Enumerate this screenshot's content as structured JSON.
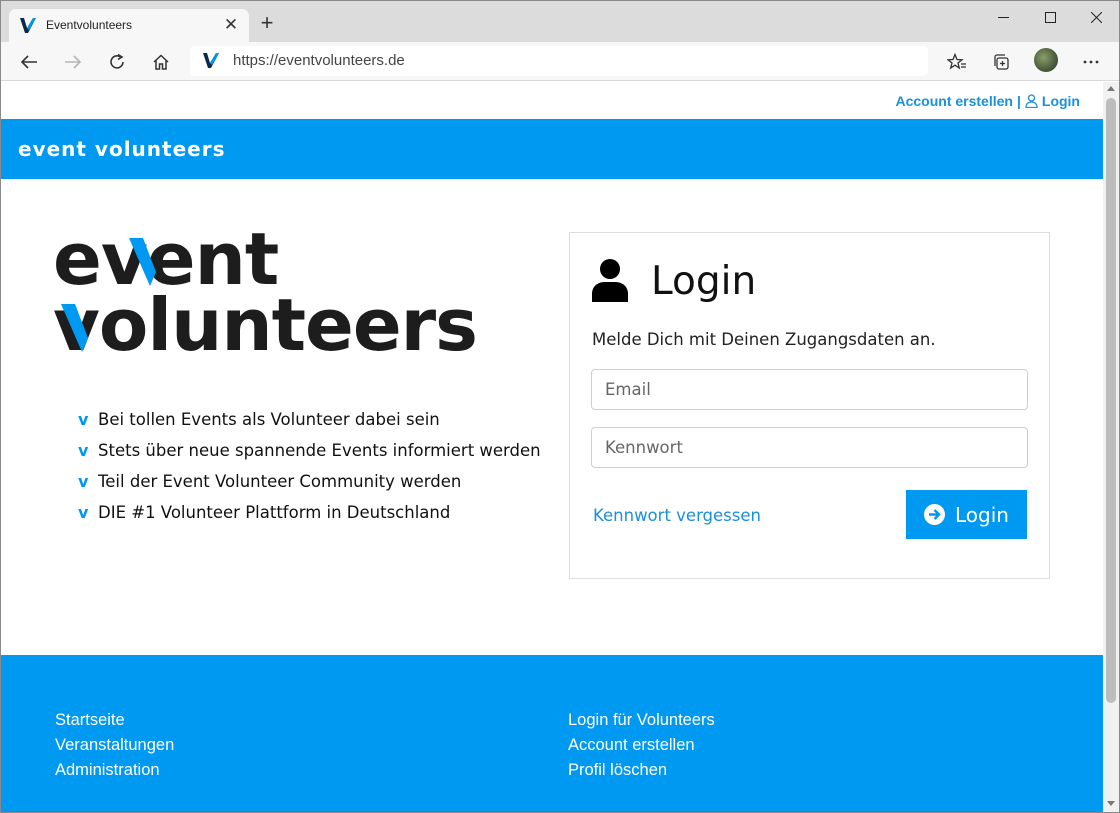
{
  "browser": {
    "tab_title": "Eventvolunteers",
    "tab_close": "✕",
    "new_tab": "+",
    "url": "https://eventvolunteers.de"
  },
  "header": {
    "account_create": "Account erstellen",
    "separator": "|",
    "login": "Login",
    "brand": "event volunteers"
  },
  "hero": {
    "logo_line1": "event",
    "logo_line2": "volunteers",
    "check_mark": "v",
    "features": [
      "Bei tollen Events als Volunteer dabei sein",
      "Stets über neue spannende Events informiert werden",
      "Teil der Event Volunteer Community werden",
      "DIE #1 Volunteer Plattform in Deutschland"
    ]
  },
  "login": {
    "title": "Login",
    "intro": "Melde Dich mit Deinen Zugangsdaten an.",
    "email_placeholder": "Email",
    "password_placeholder": "Kennwort",
    "forgot": "Kennwort vergessen",
    "button": "Login"
  },
  "footer": {
    "left": [
      "Startseite",
      "Veranstaltungen",
      "Administration"
    ],
    "right": [
      "Login für Volunteers",
      "Account erstellen",
      "Profil löschen"
    ]
  },
  "colors": {
    "brand_blue": "#0099f2",
    "link_blue": "#1a8fdc",
    "logo_dark": "#1d1d1d"
  }
}
